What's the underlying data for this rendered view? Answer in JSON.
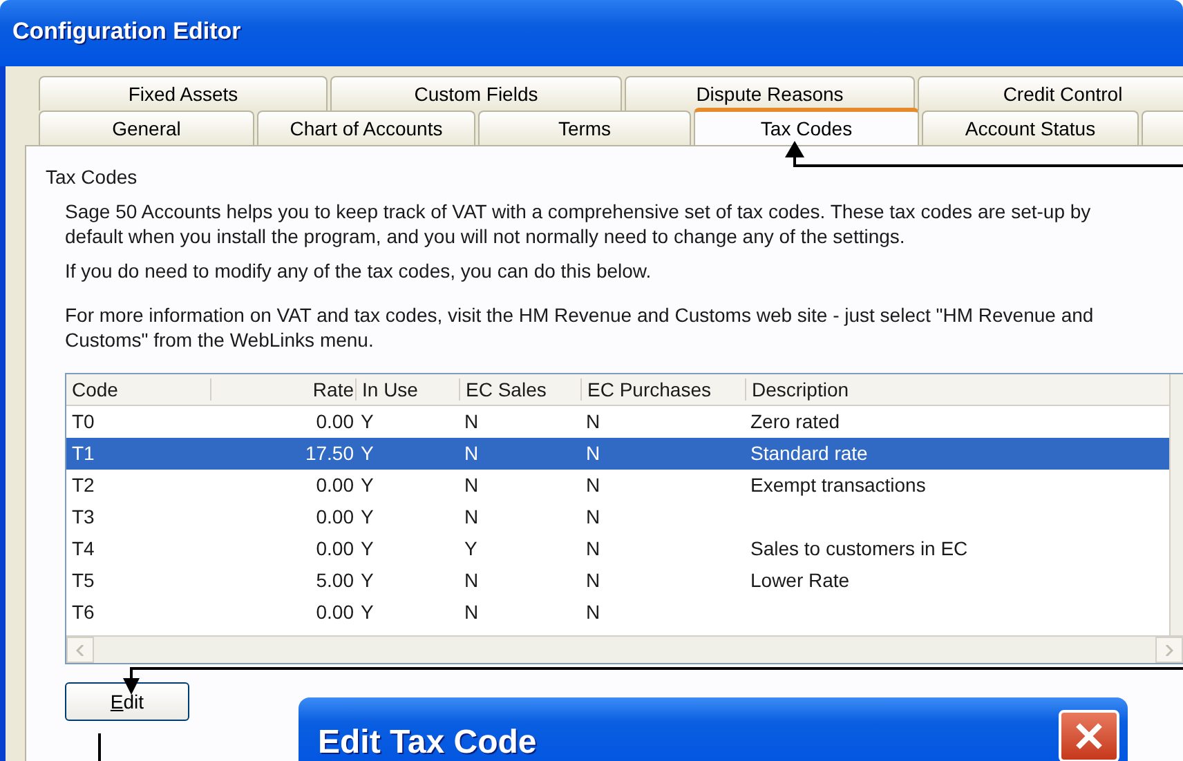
{
  "window": {
    "title": "Configuration Editor"
  },
  "tab_rows": [
    {
      "tabs": [
        {
          "label": "Fixed Assets",
          "selected": false
        },
        {
          "label": "Custom Fields",
          "selected": false
        },
        {
          "label": "Dispute Reasons",
          "selected": false
        },
        {
          "label": "Credit Control",
          "selected": false
        }
      ]
    },
    {
      "tabs": [
        {
          "label": "General",
          "selected": false
        },
        {
          "label": "Chart of Accounts",
          "selected": false
        },
        {
          "label": "Terms",
          "selected": false
        },
        {
          "label": "Tax Codes",
          "selected": true
        },
        {
          "label": "Account Status",
          "selected": false
        }
      ]
    }
  ],
  "panel": {
    "heading": "Tax Codes",
    "paragraphs": [
      "Sage 50 Accounts helps you to keep track of VAT with a comprehensive set of tax codes. These tax codes are set-up by default when you install the program, and you will not normally need to change any of the settings.",
      "If you do need to modify any of the tax codes, you can do this below.",
      "For more information on VAT and tax codes, visit the HM Revenue and Customs web site - just select \"HM Revenue and Customs\" from the WebLinks menu."
    ]
  },
  "table": {
    "columns": [
      "Code",
      "Rate",
      "In Use",
      "EC Sales",
      "EC Purchases",
      "Description"
    ],
    "rows": [
      {
        "cells": [
          "T0",
          "0.00",
          "Y",
          "N",
          "N",
          "Zero rated"
        ],
        "selected": false
      },
      {
        "cells": [
          "T1",
          "17.50",
          "Y",
          "N",
          "N",
          "Standard rate"
        ],
        "selected": true
      },
      {
        "cells": [
          "T2",
          "0.00",
          "Y",
          "N",
          "N",
          "Exempt transactions"
        ],
        "selected": false
      },
      {
        "cells": [
          "T3",
          "0.00",
          "Y",
          "N",
          "N",
          ""
        ],
        "selected": false
      },
      {
        "cells": [
          "T4",
          "0.00",
          "Y",
          "Y",
          "N",
          "Sales to customers in EC"
        ],
        "selected": false
      },
      {
        "cells": [
          "T5",
          "5.00",
          "Y",
          "N",
          "N",
          "Lower Rate"
        ],
        "selected": false
      },
      {
        "cells": [
          "T6",
          "0.00",
          "Y",
          "N",
          "N",
          ""
        ],
        "selected": false
      }
    ]
  },
  "edit_button": {
    "label": "Edit"
  },
  "dialog": {
    "title": "Edit Tax Code"
  }
}
